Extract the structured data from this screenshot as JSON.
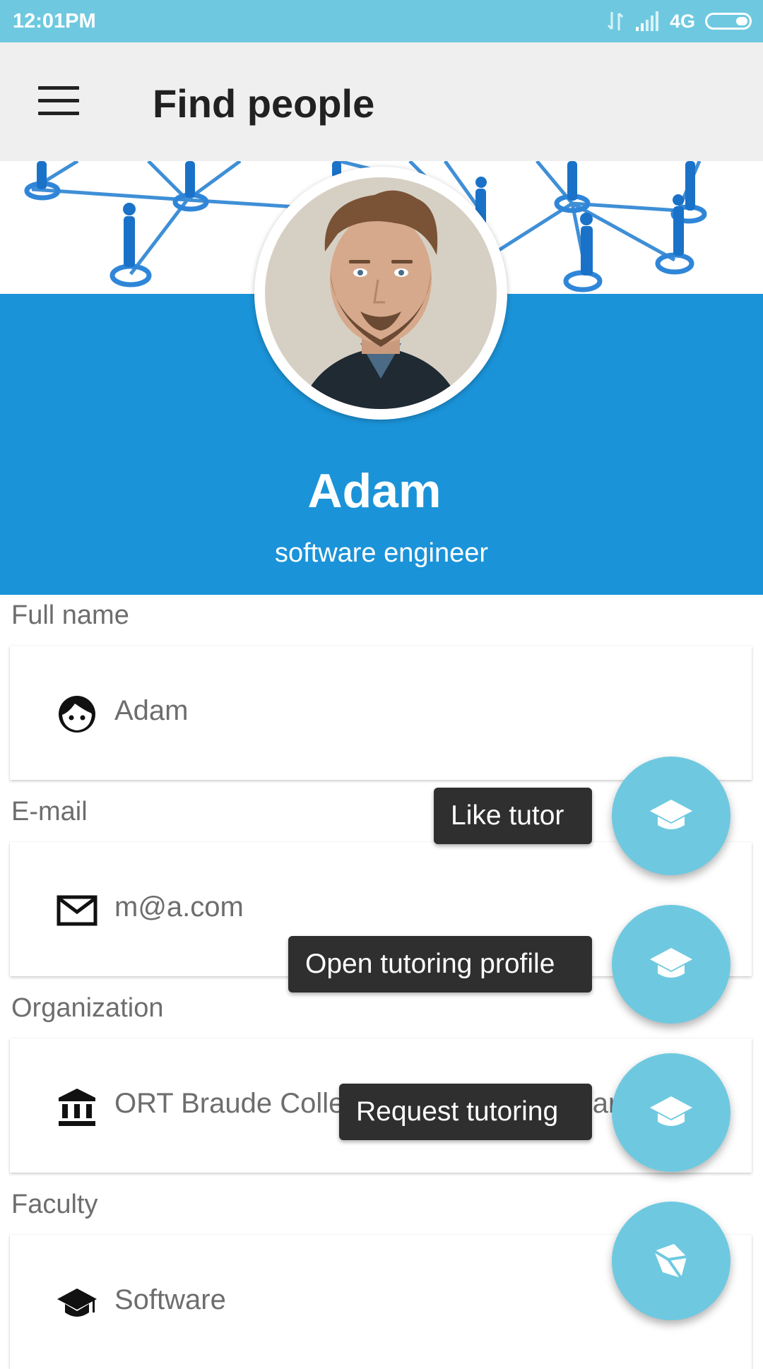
{
  "status_bar": {
    "time": "12:01PM",
    "network": "4G"
  },
  "app_bar": {
    "title": "Find people"
  },
  "profile": {
    "name": "Adam",
    "role": "software engineer"
  },
  "fields": [
    {
      "label": "Full name",
      "value": "Adam",
      "icon": "face-icon"
    },
    {
      "label": "E-mail",
      "value": "m@a.com",
      "icon": "mail-icon"
    },
    {
      "label": "Organization",
      "value": "ORT Braude College of Engineering Karmiel",
      "icon": "institution-icon"
    },
    {
      "label": "Faculty",
      "value": "Software",
      "icon": "graduation-cap-icon"
    }
  ],
  "fab_actions": [
    {
      "tooltip": "Like tutor",
      "icon": "school-icon"
    },
    {
      "tooltip": "Open tutoring profile",
      "icon": "school-icon"
    },
    {
      "tooltip": "Request tutoring",
      "icon": "school-icon"
    }
  ],
  "main_fab": {
    "icon": "open-box-icon"
  },
  "colors": {
    "status_bar": "#6ec9e0",
    "header_blue": "#1b93d8",
    "fab": "#6ec9e0",
    "app_bar": "#efefef"
  }
}
